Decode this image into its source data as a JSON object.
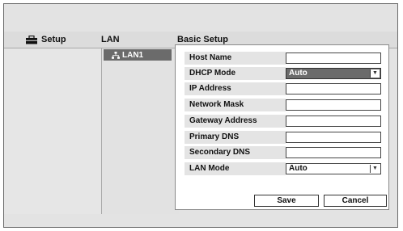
{
  "header": {
    "setup_label": "Setup",
    "lan_label": "LAN",
    "page_title": "Basic Setup"
  },
  "nav": {
    "lan1_label": "LAN1"
  },
  "form": {
    "host_name_label": "Host Name",
    "host_name_value": "",
    "dhcp_mode_label": "DHCP Mode",
    "dhcp_mode_value": "Auto",
    "ip_address_label": "IP Address",
    "ip_address_value": "",
    "network_mask_label": "Network Mask",
    "network_mask_value": "",
    "gateway_label": "Gateway Address",
    "gateway_value": "",
    "primary_dns_label": "Primary DNS",
    "primary_dns_value": "",
    "secondary_dns_label": "Secondary DNS",
    "secondary_dns_value": "",
    "lan_mode_label": "LAN Mode",
    "lan_mode_value": "Auto"
  },
  "actions": {
    "save_label": "Save",
    "cancel_label": "Cancel"
  },
  "icons": {
    "setup": "toolbox-icon",
    "lan1": "network-icon",
    "dropdown": "triangle-down-icon"
  },
  "colors": {
    "selected_bg": "#6b6b6b",
    "frame_bg": "#e3e3e3"
  }
}
